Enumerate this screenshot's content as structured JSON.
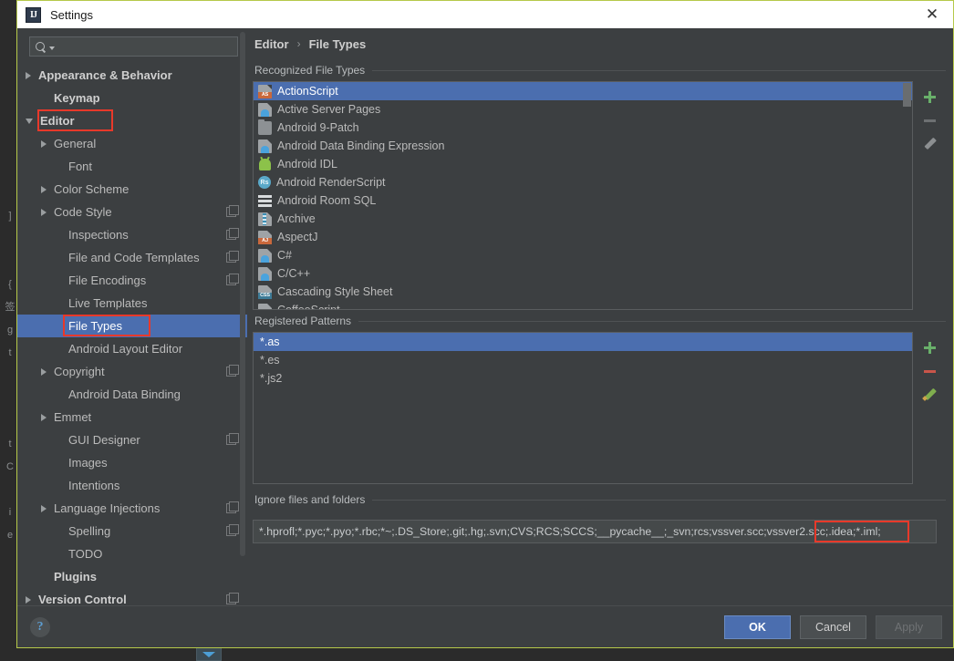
{
  "window": {
    "title": "Settings",
    "app_icon": "IJ",
    "close_icon": "✕"
  },
  "search": {
    "value": "",
    "placeholder": "",
    "icon": "search-icon"
  },
  "sidebar": {
    "scroll": "visible",
    "items": [
      {
        "label": "Appearance & Behavior",
        "arrow": "right",
        "indent": 0,
        "bold": true,
        "copy": false
      },
      {
        "label": "Keymap",
        "arrow": "none",
        "indent": 1,
        "bold": true,
        "copy": false
      },
      {
        "label": "Editor",
        "arrow": "down",
        "indent": 0,
        "bold": true,
        "copy": false,
        "annotated": true
      },
      {
        "label": "General",
        "arrow": "right",
        "indent": 1,
        "bold": false,
        "copy": false
      },
      {
        "label": "Font",
        "arrow": "none",
        "indent": 2,
        "bold": false,
        "copy": false
      },
      {
        "label": "Color Scheme",
        "arrow": "right",
        "indent": 1,
        "bold": false,
        "copy": false
      },
      {
        "label": "Code Style",
        "arrow": "right",
        "indent": 1,
        "bold": false,
        "copy": true
      },
      {
        "label": "Inspections",
        "arrow": "none",
        "indent": 2,
        "bold": false,
        "copy": true
      },
      {
        "label": "File and Code Templates",
        "arrow": "none",
        "indent": 2,
        "bold": false,
        "copy": true
      },
      {
        "label": "File Encodings",
        "arrow": "none",
        "indent": 2,
        "bold": false,
        "copy": true
      },
      {
        "label": "Live Templates",
        "arrow": "none",
        "indent": 2,
        "bold": false,
        "copy": false
      },
      {
        "label": "File Types",
        "arrow": "none",
        "indent": 2,
        "bold": false,
        "copy": false,
        "selected": true,
        "annotated": true
      },
      {
        "label": "Android Layout Editor",
        "arrow": "none",
        "indent": 2,
        "bold": false,
        "copy": false
      },
      {
        "label": "Copyright",
        "arrow": "right",
        "indent": 1,
        "bold": false,
        "copy": true
      },
      {
        "label": "Android Data Binding",
        "arrow": "none",
        "indent": 2,
        "bold": false,
        "copy": false
      },
      {
        "label": "Emmet",
        "arrow": "right",
        "indent": 1,
        "bold": false,
        "copy": false
      },
      {
        "label": "GUI Designer",
        "arrow": "none",
        "indent": 2,
        "bold": false,
        "copy": true
      },
      {
        "label": "Images",
        "arrow": "none",
        "indent": 2,
        "bold": false,
        "copy": false
      },
      {
        "label": "Intentions",
        "arrow": "none",
        "indent": 2,
        "bold": false,
        "copy": false
      },
      {
        "label": "Language Injections",
        "arrow": "right",
        "indent": 1,
        "bold": false,
        "copy": true
      },
      {
        "label": "Spelling",
        "arrow": "none",
        "indent": 2,
        "bold": false,
        "copy": true
      },
      {
        "label": "TODO",
        "arrow": "none",
        "indent": 2,
        "bold": false,
        "copy": false
      },
      {
        "label": "Plugins",
        "arrow": "none",
        "indent": 1,
        "bold": true,
        "copy": false
      },
      {
        "label": "Version Control",
        "arrow": "right",
        "indent": 0,
        "bold": true,
        "copy": true
      }
    ]
  },
  "breadcrumb": {
    "parent": "Editor",
    "separator": "›",
    "current": "File Types"
  },
  "recognized": {
    "group_label": "Recognized File Types",
    "items": [
      {
        "name": "ActionScript",
        "icon": "actionscript-file-icon",
        "selected": true
      },
      {
        "name": "Active Server Pages",
        "icon": "asp-file-icon",
        "selected": false
      },
      {
        "name": "Android 9-Patch",
        "icon": "folder-icon",
        "selected": false
      },
      {
        "name": "Android Data Binding Expression",
        "icon": "data-binding-file-icon",
        "selected": false
      },
      {
        "name": "Android IDL",
        "icon": "android-icon",
        "selected": false
      },
      {
        "name": "Android RenderScript",
        "icon": "renderscript-icon",
        "selected": false
      },
      {
        "name": "Android Room SQL",
        "icon": "sql-icon",
        "selected": false
      },
      {
        "name": "Archive",
        "icon": "archive-zip-icon",
        "selected": false
      },
      {
        "name": "AspectJ",
        "icon": "aspectj-file-icon",
        "selected": false
      },
      {
        "name": "C#",
        "icon": "csharp-file-icon",
        "selected": false
      },
      {
        "name": "C/C++",
        "icon": "cpp-file-icon",
        "selected": false
      },
      {
        "name": "Cascading Style Sheet",
        "icon": "css-file-icon",
        "selected": false
      },
      {
        "name": "CoffeeScript",
        "icon": "coffeescript-file-icon",
        "selected": false,
        "clipped": true
      }
    ],
    "buttons": [
      {
        "name": "add",
        "icon": "plus-icon",
        "enabled": true
      },
      {
        "name": "remove",
        "icon": "minus-icon",
        "enabled": false
      },
      {
        "name": "edit",
        "icon": "pencil-icon",
        "enabled": false
      }
    ]
  },
  "patterns": {
    "group_label": "Registered Patterns",
    "items": [
      {
        "value": "*.as",
        "selected": true
      },
      {
        "value": "*.es",
        "selected": false
      },
      {
        "value": "*.js2",
        "selected": false
      }
    ],
    "buttons": [
      {
        "name": "add",
        "icon": "plus-icon",
        "enabled": true
      },
      {
        "name": "remove",
        "icon": "minus-icon",
        "enabled": true
      },
      {
        "name": "edit",
        "icon": "pencil-icon",
        "enabled": true
      }
    ]
  },
  "ignore": {
    "group_label": "Ignore files and folders",
    "value_prefix": "*.hprofl;*.pyc;*.pyo;*.rbc;*~;.DS_Store;.git;.hg;.svn;CVS;RCS;SCCS;__pycache__;_svn;rcs;vssver.scc;vssver2.sc",
    "value_highlighted": "c;.idea;*.iml;",
    "full_value": "*.hprofl;*.pyc;*.pyo;*.rbc;*~;.DS_Store;.git;.hg;.svn;CVS;RCS;SCCS;__pycache__;_svn;rcs;vssver.scc;vssver2.scc;.idea;*.iml;"
  },
  "footer": {
    "help_label": "?",
    "ok_label": "OK",
    "cancel_label": "Cancel",
    "apply_label": "Apply"
  },
  "background_strip": {
    "chars": [
      "",
      "",
      "",
      "",
      "",
      "",
      "",
      "",
      "",
      "]",
      "",
      "",
      "{",
      "签",
      "g",
      "t",
      "",
      "",
      "",
      "t",
      "C",
      "",
      "i",
      "e",
      "",
      "",
      "",
      ""
    ]
  },
  "colors": {
    "selection": "#4b6eaf",
    "annotation": "#e8392a",
    "window_border": "#b6c94a",
    "panel_bg": "#3c3f41",
    "add_green": "#69b06a",
    "remove_red": "#c9554a"
  }
}
